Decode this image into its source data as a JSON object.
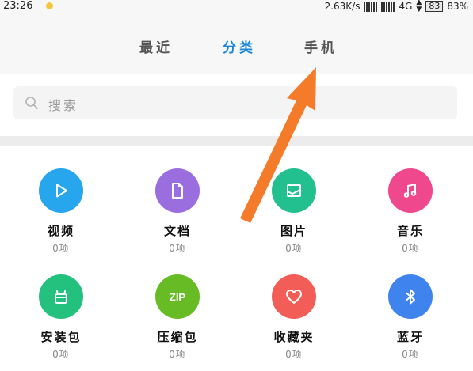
{
  "status_bar": {
    "time": "23:26",
    "net_speed": "2.63K/s",
    "network": "4G",
    "battery_level": "83",
    "battery_percent": "83%"
  },
  "tabs": [
    {
      "label": "最近",
      "active": false
    },
    {
      "label": "分类",
      "active": true
    },
    {
      "label": "手机",
      "active": false
    }
  ],
  "search": {
    "placeholder": "搜索"
  },
  "categories": [
    {
      "label": "视频",
      "count": "0项",
      "icon": "video-play-icon",
      "color": "#27a6ee"
    },
    {
      "label": "文档",
      "count": "0项",
      "icon": "document-icon",
      "color": "#9b6ee0"
    },
    {
      "label": "图片",
      "count": "0项",
      "icon": "image-icon",
      "color": "#22c08f"
    },
    {
      "label": "音乐",
      "count": "0项",
      "icon": "music-note-icon",
      "color": "#f0488c"
    },
    {
      "label": "安装包",
      "count": "0项",
      "icon": "android-package-icon",
      "color": "#24c07e"
    },
    {
      "label": "压缩包",
      "count": "0项",
      "icon": "zip-icon",
      "color": "#67bb25",
      "icon_text": "ZIP"
    },
    {
      "label": "收藏夹",
      "count": "0项",
      "icon": "heart-icon",
      "color": "#f25e57"
    },
    {
      "label": "蓝牙",
      "count": "0项",
      "icon": "bluetooth-icon",
      "color": "#3f83ee"
    }
  ],
  "annotation": {
    "color": "#f47b2a"
  }
}
